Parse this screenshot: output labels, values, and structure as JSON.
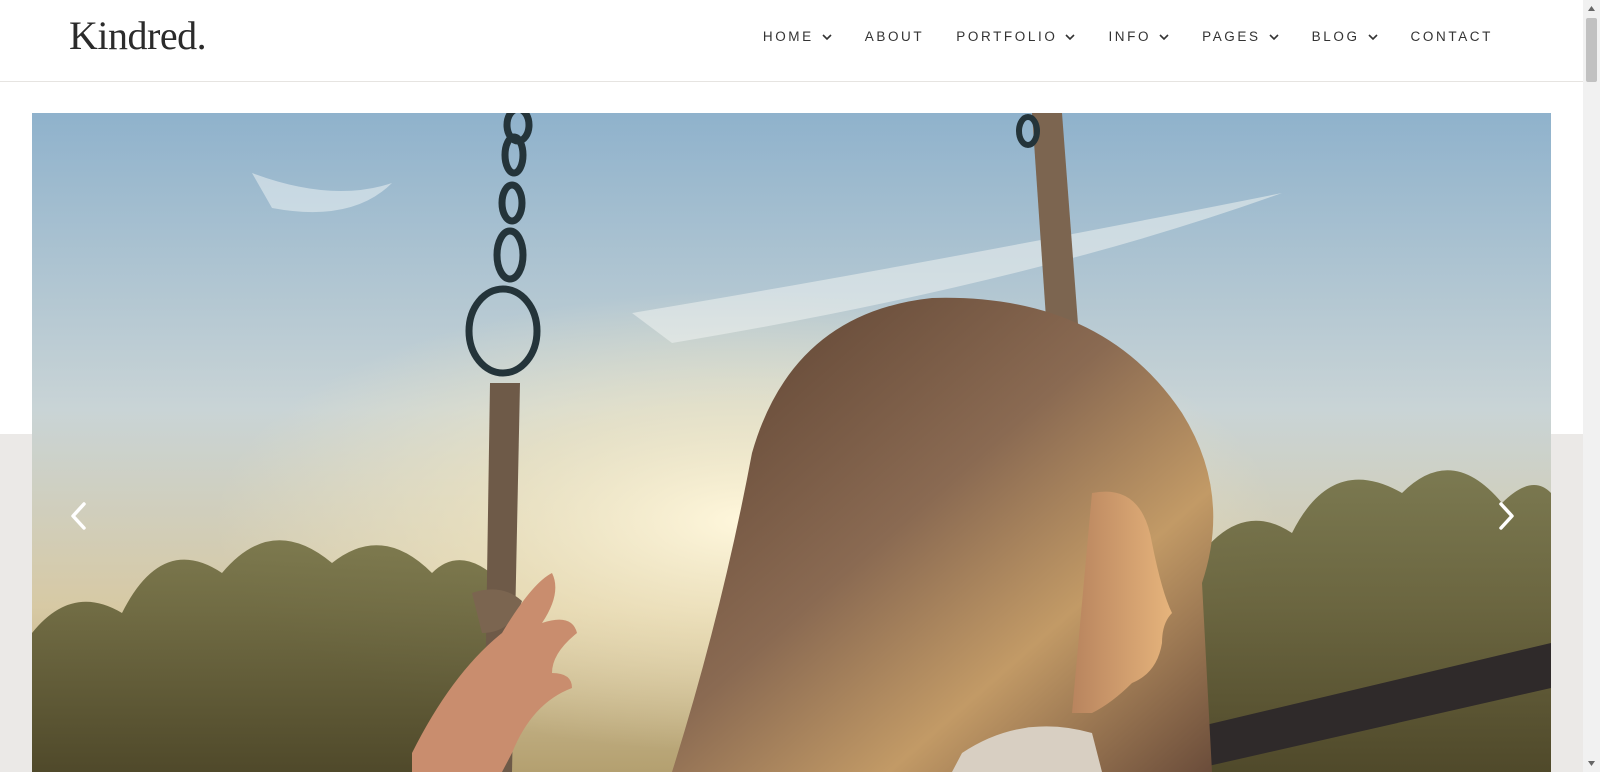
{
  "brand": {
    "logo_text": "Kindred."
  },
  "nav": {
    "items": [
      {
        "label": "HOME",
        "has_dropdown": true
      },
      {
        "label": "ABOUT",
        "has_dropdown": false
      },
      {
        "label": "PORTFOLIO",
        "has_dropdown": true
      },
      {
        "label": "INFO",
        "has_dropdown": true
      },
      {
        "label": "PAGES",
        "has_dropdown": true
      },
      {
        "label": "BLOG",
        "has_dropdown": true
      },
      {
        "label": "CONTACT",
        "has_dropdown": false
      }
    ]
  },
  "hero": {
    "image": "girl-on-swing-sunset-photo",
    "prev_icon": "chevron-left-icon",
    "next_icon": "chevron-right-icon"
  },
  "colors": {
    "text": "#333333",
    "header_border": "#e6e4e1",
    "band": "#ebe9e7",
    "sky_top": "#8fb2cc",
    "sun": "#fff7dc"
  }
}
